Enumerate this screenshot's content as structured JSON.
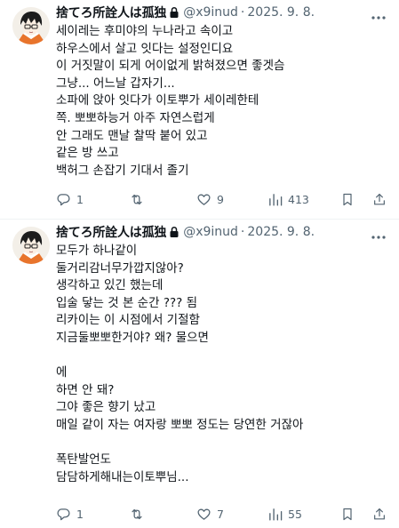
{
  "tweets": [
    {
      "author_name": "捨てろ所詮人は孤独",
      "handle": "@x9inud",
      "separator": "·",
      "date": "2025. 9. 8.",
      "lines": [
        "세이레는 후미야의 누나라고 속이고",
        "하우스에서 살고 잇다는 설정인디요",
        "이 거짓말이 되게 어이없게 밝혀졌으면 좋겟슴",
        "그냥... 어느날 갑자기...",
        "소파에 앉아 잇다가 이토뿌가 세이레한테",
        "쪽. 뽀뽀하능거 아주 자연스럽게",
        "안 그래도 맨날 찰딱 붙어 있고",
        "같은 방 쓰고",
        "백허그 손잡기 기대서 졸기"
      ],
      "stats": {
        "replies": "1",
        "retweets": "",
        "likes": "9",
        "views": "413"
      }
    },
    {
      "author_name": "捨てろ所詮人は孤独",
      "handle": "@x9inud",
      "separator": "·",
      "date": "2025. 9. 8.",
      "lines": [
        "모두가 하나같이",
        "둘거리감너무가깝지않아?",
        "생각하고 있긴 했는데",
        "입술 닿는 것 본 순간 ??? 됨",
        "리카이는 이 시점에서 기절함",
        "지금둘뽀뽀한거야? 왜? 물으면",
        "",
        "에",
        "하면 안 돼?",
        "그야 좋은 향기 났고",
        "매일 같이 자는 여자랑 뽀뽀 정도는 당연한 거잖아",
        "",
        "폭탄발언도",
        "담담하게해내는이토뿌님..."
      ],
      "stats": {
        "replies": "1",
        "retweets": "",
        "likes": "7",
        "views": "55"
      }
    }
  ],
  "icons": {
    "reply": "reply-icon",
    "retweet": "retweet-icon",
    "like": "heart-icon",
    "views": "views-icon",
    "bookmark": "bookmark-icon",
    "share": "share-icon",
    "more": "more-icon",
    "lock": "lock-icon",
    "avatar": "avatar"
  },
  "colors": {
    "text": "#0f1419",
    "secondary": "#536471",
    "divider": "#eff3f4",
    "avatar_accent": "#e8742c"
  }
}
